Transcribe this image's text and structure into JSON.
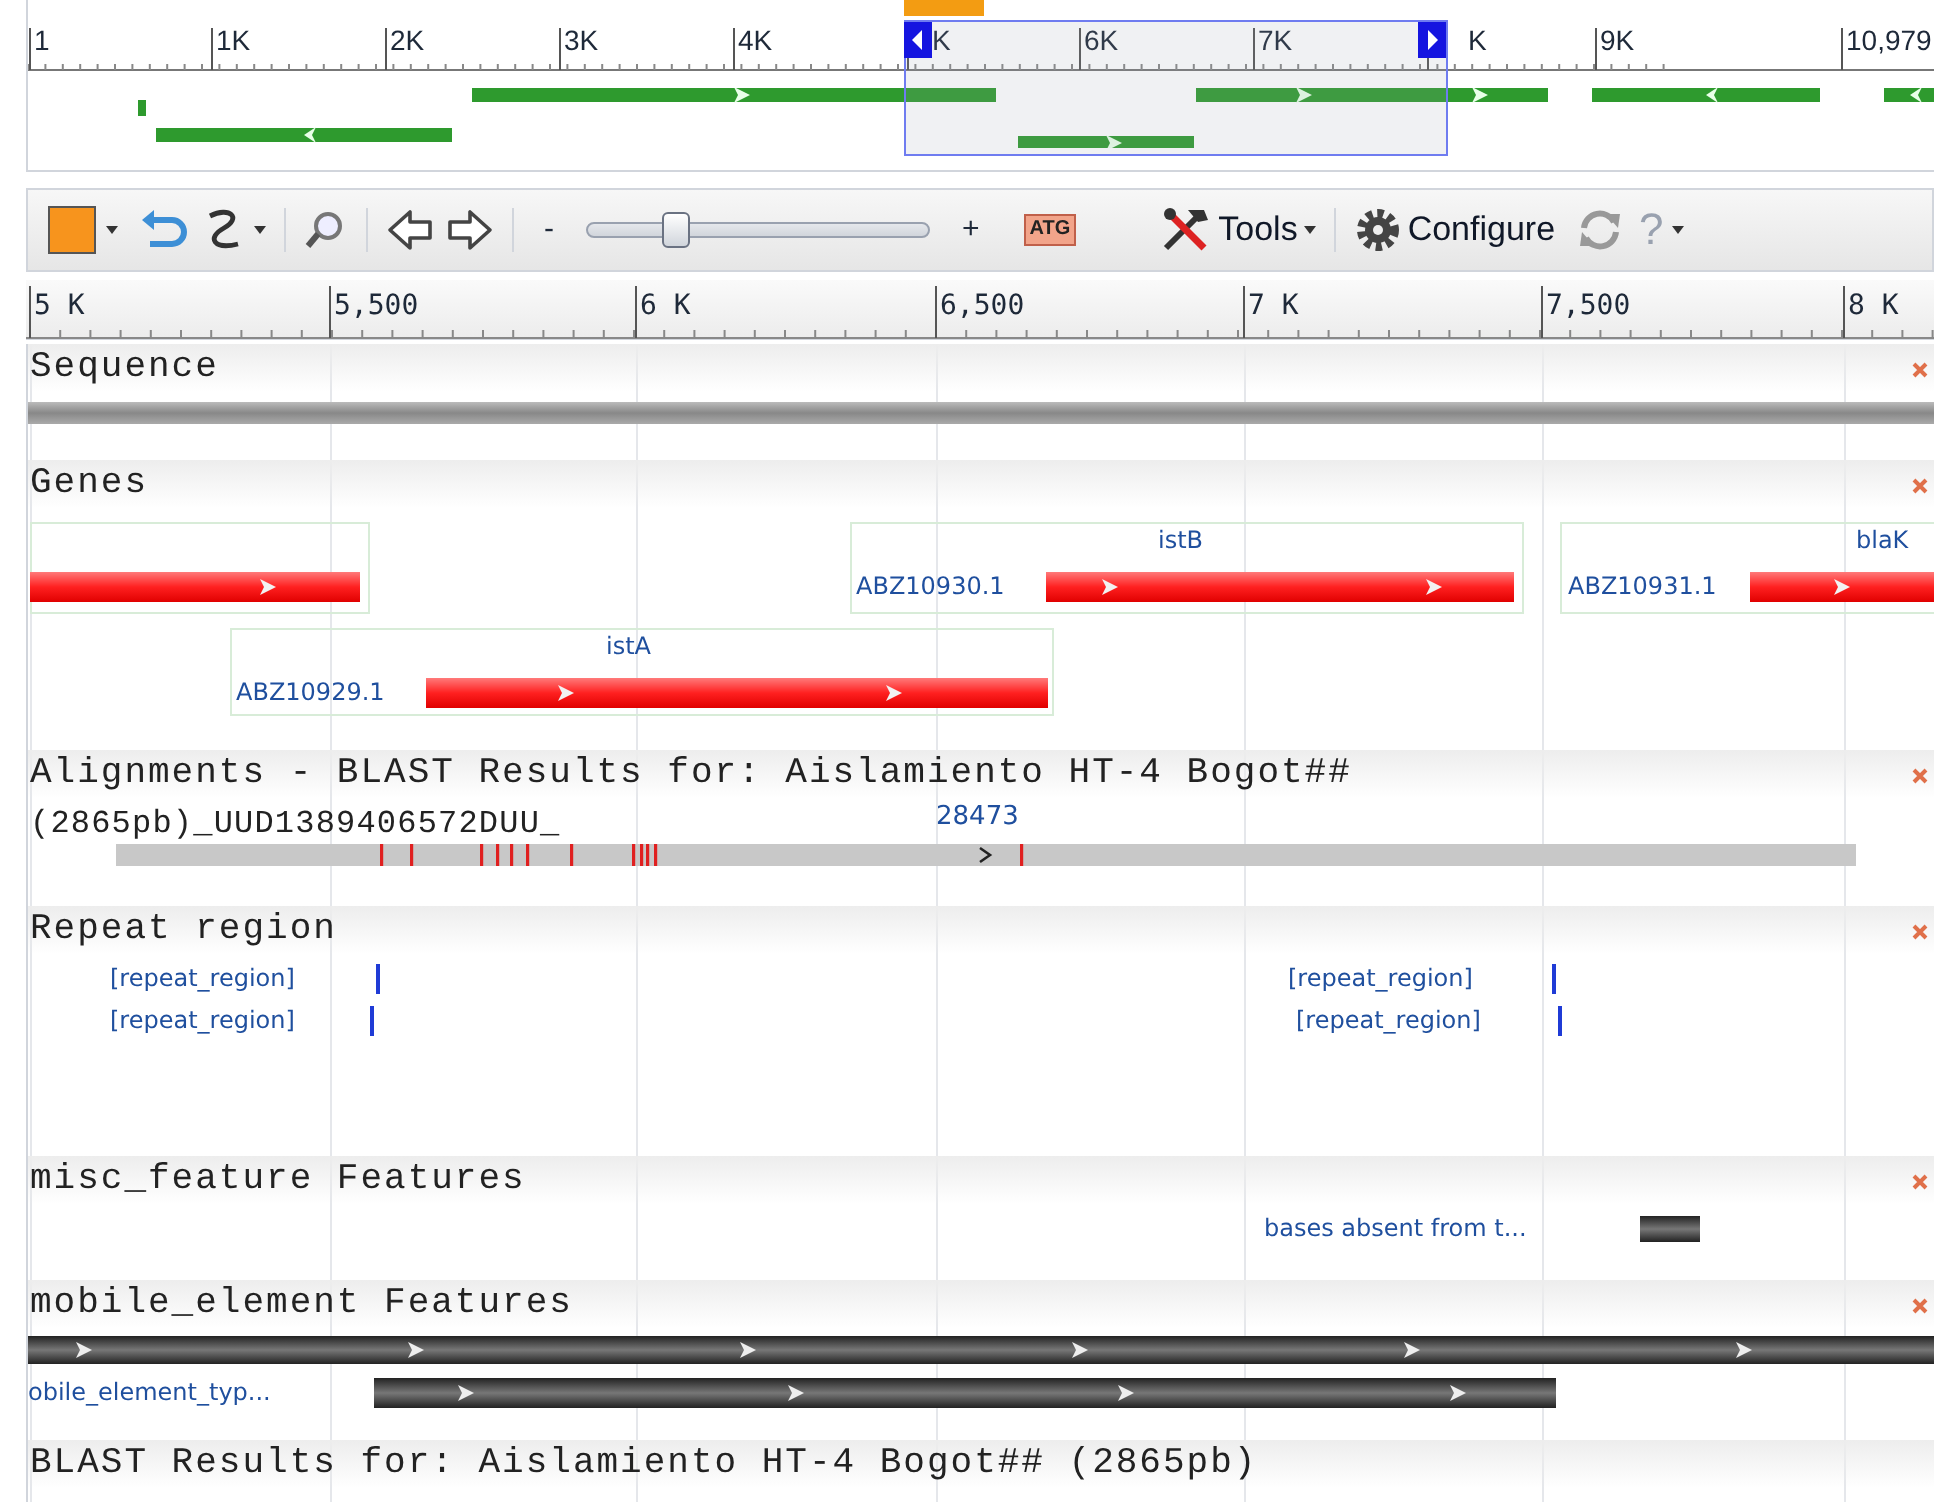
{
  "overview": {
    "ticks": [
      "1",
      "1K",
      "2K",
      "3K",
      "4K",
      "K",
      "6K",
      "7K",
      "K",
      "9K",
      "10,979"
    ]
  },
  "toolbar": {
    "zoom_out": "-",
    "zoom_slider": {
      "level": 0.24
    },
    "zoom_in": "+",
    "sequence_icon": "ATG",
    "tools": "Tools",
    "configure": "Configure",
    "help": "?"
  },
  "ruler": {
    "ticks": [
      "5 K",
      "5,500",
      "6 K",
      "6,500",
      "7 K",
      "7,500",
      "8 K"
    ]
  },
  "tracks": [
    {
      "kind": "sequence",
      "title": "Sequence"
    },
    {
      "kind": "genes",
      "title": "Genes",
      "features": [
        {
          "kind": "unlabeled"
        },
        {
          "kind": "labeled",
          "name": "istB",
          "accession": "ABZ10930.1"
        },
        {
          "kind": "labeled",
          "name": "blaK",
          "accession": "ABZ10931.1"
        },
        {
          "kind": "labeled",
          "name": "istA",
          "accession": "ABZ10929.1"
        }
      ]
    },
    {
      "kind": "alignments",
      "title": "Alignments - BLAST Results for: Aislamiento HT-4 Bogot##",
      "subject": "(2865pb)_UUD1389406572DUU_",
      "marker": "28473"
    },
    {
      "kind": "repeats",
      "title": "Repeat region",
      "features": [
        {
          "label": "[repeat_region]"
        },
        {
          "label": "[repeat_region]"
        },
        {
          "label": "[repeat_region]"
        },
        {
          "label": "[repeat_region]"
        }
      ]
    },
    {
      "kind": "misc",
      "title": "misc_feature Features",
      "features": [
        {
          "label": "bases absent from t..."
        }
      ]
    },
    {
      "kind": "mobile",
      "title": "mobile_element Features",
      "features": [
        {
          "kind": "unlabeled"
        },
        {
          "kind": "labeled",
          "label": "obile_element_typ..."
        }
      ]
    },
    {
      "kind": "header",
      "title": "BLAST Results for: Aislamiento HT-4 Bogot## (2865pb)"
    }
  ]
}
